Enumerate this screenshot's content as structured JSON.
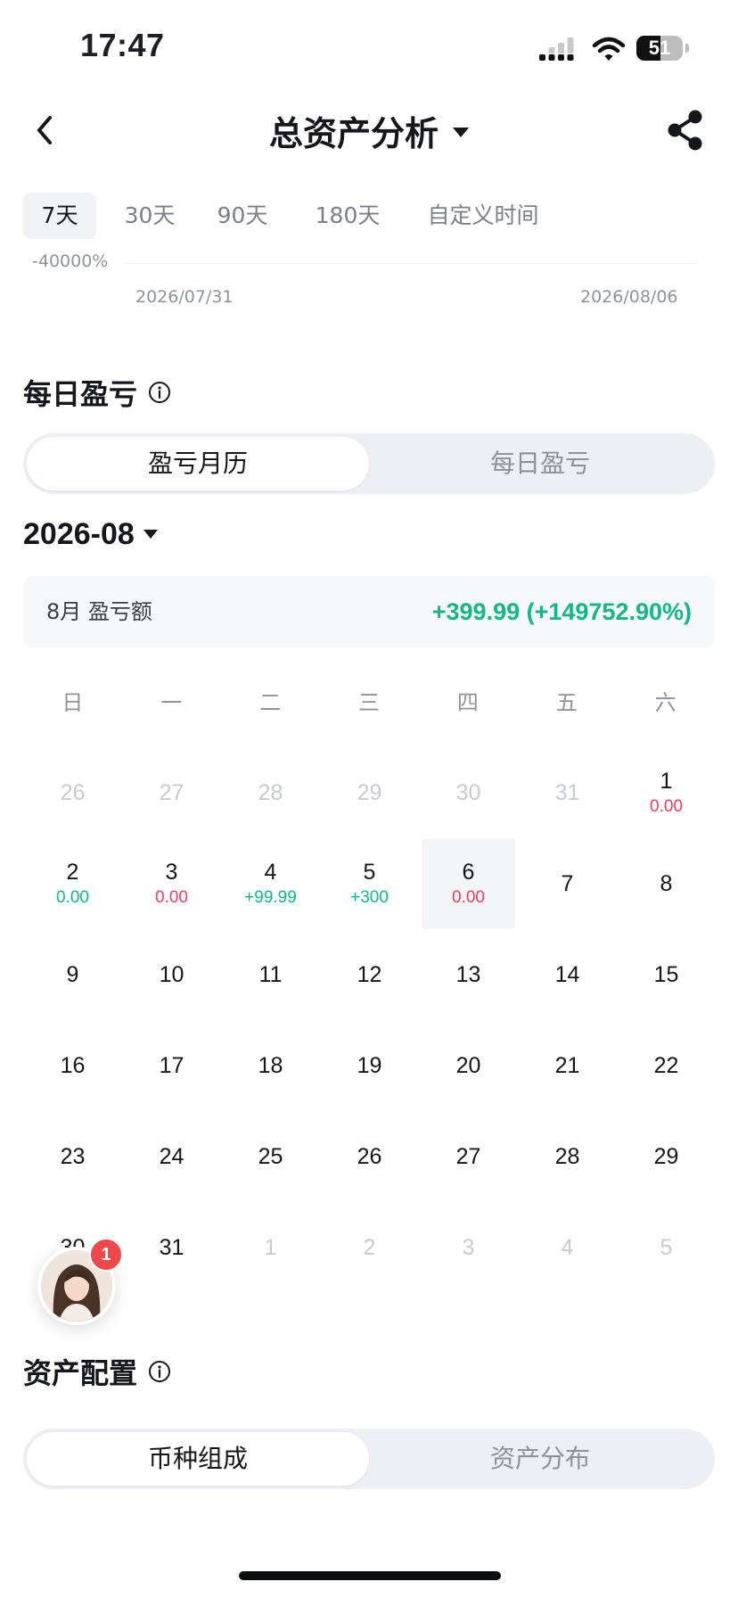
{
  "status_bar": {
    "time": "17:47",
    "battery_level": "51",
    "battery_fraction": 0.51,
    "icons": [
      "signal-icon",
      "wifi-icon",
      "battery-icon"
    ]
  },
  "nav": {
    "title": "总资产分析",
    "icons": [
      "back-icon",
      "dropdown-caret-icon",
      "share-icon"
    ]
  },
  "range_tabs": [
    {
      "label": "7天",
      "active": true
    },
    {
      "label": "30天",
      "active": false
    },
    {
      "label": "90天",
      "active": false
    },
    {
      "label": "180天",
      "active": false
    },
    {
      "label": "自定义时间",
      "active": false
    }
  ],
  "chart": {
    "y_label": "-40000%",
    "x_start": "2026/07/31",
    "x_end": "2026/08/06"
  },
  "daily_pnl": {
    "title": "每日盈亏",
    "segments": {
      "active": "盈亏月历",
      "inactive": "每日盈亏"
    },
    "month": "2026-08",
    "summary": {
      "label": "8月 盈亏额",
      "value": "+399.99 (+149752.90%)"
    },
    "weekdays": [
      "日",
      "一",
      "二",
      "三",
      "四",
      "五",
      "六"
    ],
    "days": [
      {
        "day": "26",
        "muted": true
      },
      {
        "day": "27",
        "muted": true
      },
      {
        "day": "28",
        "muted": true
      },
      {
        "day": "29",
        "muted": true
      },
      {
        "day": "30",
        "muted": true
      },
      {
        "day": "31",
        "muted": true
      },
      {
        "day": "1",
        "pnl": "0.00",
        "tone": "red"
      },
      {
        "day": "2",
        "pnl": "0.00",
        "tone": "green"
      },
      {
        "day": "3",
        "pnl": "0.00",
        "tone": "red"
      },
      {
        "day": "4",
        "pnl": "+99.99",
        "tone": "green"
      },
      {
        "day": "5",
        "pnl": "+300",
        "tone": "green"
      },
      {
        "day": "6",
        "pnl": "0.00",
        "tone": "red",
        "today": true
      },
      {
        "day": "7"
      },
      {
        "day": "8"
      },
      {
        "day": "9"
      },
      {
        "day": "10"
      },
      {
        "day": "11"
      },
      {
        "day": "12"
      },
      {
        "day": "13"
      },
      {
        "day": "14"
      },
      {
        "day": "15"
      },
      {
        "day": "16"
      },
      {
        "day": "17"
      },
      {
        "day": "18"
      },
      {
        "day": "19"
      },
      {
        "day": "20"
      },
      {
        "day": "21"
      },
      {
        "day": "22"
      },
      {
        "day": "23"
      },
      {
        "day": "24"
      },
      {
        "day": "25"
      },
      {
        "day": "26"
      },
      {
        "day": "27"
      },
      {
        "day": "28"
      },
      {
        "day": "29"
      },
      {
        "day": "30"
      },
      {
        "day": "31"
      },
      {
        "day": "1",
        "muted": true
      },
      {
        "day": "2",
        "muted": true
      },
      {
        "day": "3",
        "muted": true
      },
      {
        "day": "4",
        "muted": true
      },
      {
        "day": "5",
        "muted": true
      }
    ]
  },
  "floating_support": {
    "badge_count": "1"
  },
  "asset_allocation": {
    "title": "资产配置",
    "segments": {
      "active": "币种组成",
      "inactive": "资产分布"
    }
  },
  "colors": {
    "up_green": "#14b881",
    "down_red": "#e8405f",
    "text_primary": "#15171c",
    "text_secondary": "#8f939b",
    "segment_bg": "#eeeff4"
  }
}
